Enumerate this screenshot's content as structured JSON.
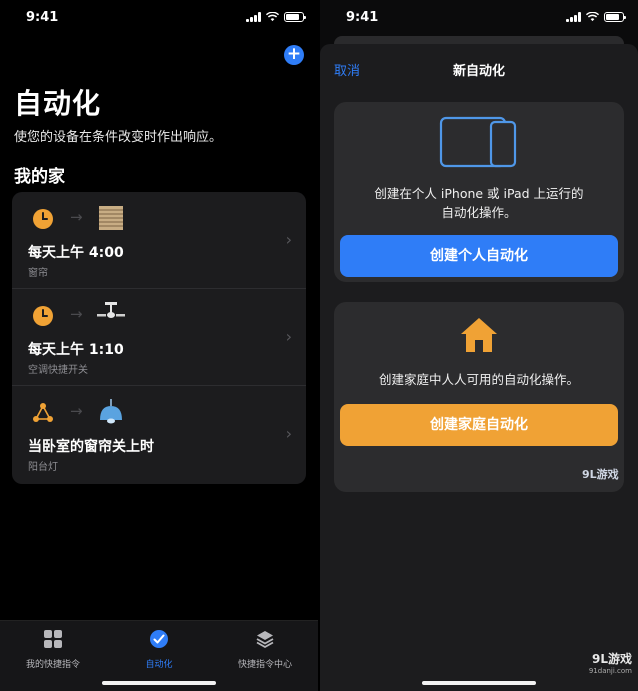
{
  "left": {
    "status": {
      "time": "9:41"
    },
    "title": "自动化",
    "subtitle": "使您的设备在条件改变时作出响应。",
    "section": "我的家",
    "items": [
      {
        "label": "每天上午 4:00",
        "sublabel": "窗帘",
        "trigger_icon": "clock-icon",
        "target_icon": "blinds-icon"
      },
      {
        "label": "每天上午 1:10",
        "sublabel": "空调快捷开关",
        "trigger_icon": "clock-icon",
        "target_icon": "ceiling-fan-icon"
      },
      {
        "label": "当卧室的窗帘关上时",
        "sublabel": "阳台灯",
        "trigger_icon": "accessory-trigger-icon",
        "target_icon": "pendant-lamp-icon"
      }
    ],
    "tabs": [
      {
        "label": "我的快捷指令",
        "icon": "grid-icon",
        "active": false
      },
      {
        "label": "自动化",
        "icon": "automation-icon",
        "active": true
      },
      {
        "label": "快捷指令中心",
        "icon": "layers-icon",
        "active": false
      }
    ]
  },
  "right": {
    "status": {
      "time": "9:41"
    },
    "nav": {
      "cancel": "取消",
      "title": "新自动化"
    },
    "personal": {
      "desc_line1": "创建在个人 iPhone 或 iPad 上运行的",
      "desc_line2": "自动化操作。",
      "button": "创建个人自动化",
      "icon": "devices-icon"
    },
    "home": {
      "desc": "创建家庭中人人可用的自动化操作。",
      "button": "创建家庭自动化",
      "icon": "home-icon"
    }
  },
  "watermark": {
    "mid": "9L游戏",
    "corner": "9L游戏",
    "corner_sub": "91danji.com"
  },
  "colors": {
    "accent_blue": "#2f7df7",
    "accent_orange": "#f0a235",
    "card": "#1c1c1e",
    "background": "#000000"
  }
}
